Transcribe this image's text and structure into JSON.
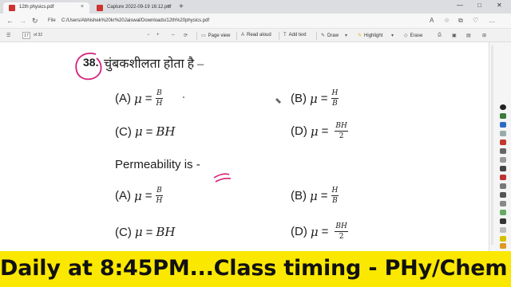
{
  "browser": {
    "tabs": [
      {
        "label": "12th physics.pdf",
        "close": "×"
      },
      {
        "label": "Capture 2022-09-19 16:12.pdf",
        "close": "×"
      }
    ],
    "new_tab": "+",
    "window_controls": [
      "—",
      "□",
      "✕"
    ],
    "nav": {
      "back": "←",
      "forward": "→",
      "reload": "↻"
    },
    "address_scheme": "File",
    "address_url": "C:/Users/Abhishek%20kr%20Jaiswal/Downloads/12th%20physics.pdf",
    "address_right_icons": [
      "A",
      "☆",
      "⧉",
      "♡",
      "…"
    ]
  },
  "pdf_toolbar": {
    "page_current": "17",
    "page_total": "of 32",
    "page_view": "Page view",
    "read_aloud": "Read aloud",
    "add_text": "Add text",
    "draw": "Draw",
    "highlight": "Highlight",
    "erase": "Erase"
  },
  "question": {
    "number": "38.",
    "hindi_text": "चुंबकशीलता होता है –",
    "english_text": "Permeability is -",
    "options_a": [
      {
        "label": "(A)",
        "mu": "μ",
        "eq": "=",
        "num": "B",
        "den": "H"
      },
      {
        "label": "(B)",
        "mu": "μ",
        "eq": "=",
        "num": "H",
        "den": "B"
      },
      {
        "label": "(C)",
        "mu": "μ",
        "eq": "=",
        "expr": "BH"
      },
      {
        "label": "(D)",
        "mu": "μ",
        "eq": "=",
        "num": "BH",
        "den": "2"
      }
    ],
    "options_b": [
      {
        "label": "(A)",
        "mu": "μ",
        "eq": "=",
        "num": "B",
        "den": "H"
      },
      {
        "label": "(B)",
        "mu": "μ",
        "eq": "=",
        "num": "H",
        "den": "B"
      },
      {
        "label": "(C)",
        "mu": "μ",
        "eq": "=",
        "expr": "BH"
      },
      {
        "label": "(D)",
        "mu": "μ",
        "eq": "=",
        "num": "BH",
        "den": "2"
      }
    ]
  },
  "banner": {
    "text": "Daily at 8:45PM...Class timing - PHy/Chem"
  },
  "colors": {
    "banner_bg": "#fbe800",
    "annotation_ink": "#d4207a",
    "tabbar_bg": "#dcdde0"
  }
}
